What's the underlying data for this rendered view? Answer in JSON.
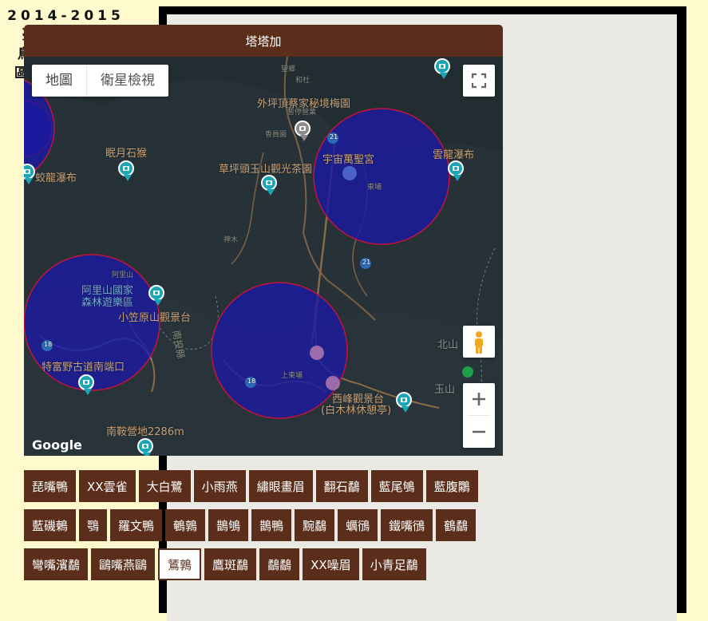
{
  "sidebar": {
    "title_lines": [
      "2014-2015",
      "臺灣新年數",
      "鳥嘉年華/樣",
      "區圓+鳥分布"
    ]
  },
  "map_panel": {
    "header": "塔塔加",
    "map_type": {
      "map_label": "地圖",
      "satellite_label": "衛星檢視"
    },
    "attribution": "Google",
    "place_labels": {
      "waishan": "外坪頂蔡家秘境梅園",
      "waishan_sub": "暫停營業",
      "caopingtou": "草坪頭玉山觀光茶園",
      "yuzhou": "宇宙萬聖宮",
      "yunlong": "雲龍瀑布",
      "meiyue": "眠月石猴",
      "jiaolong": "蛟龍瀑布",
      "alishan_forest": "阿里山國家\n森林遊樂區",
      "xiaoliyuan": "小笠原山觀景台",
      "tefu": "特富野古道南端口",
      "xifeng": "西峰觀景台",
      "xifeng_sub": "(白木林休憩亭)",
      "nanan": "南鞍營地2286m",
      "beishan": "北山",
      "yushan": "玉山",
      "road_21a": "21",
      "road_21b": "21",
      "road_18a": "18",
      "road_18b": "18",
      "alishan_small": "阿里山",
      "shenmu": "神木",
      "tataka": "上東埔",
      "heshe": "和社",
      "wangxiang": "望鄉",
      "xinzhong": "香員園",
      "dongpu": "東埔",
      "nanzhi": "南投縣"
    }
  },
  "colors": {
    "accent": "#5a2e1a",
    "circle_fill": "#1c1aa0",
    "circle_stroke": "#c0143c",
    "marker": "#1aa6b7"
  },
  "bird_buttons": {
    "rows": [
      [
        "琵嘴鴨",
        "XX雲雀",
        "大白鷺",
        "小雨燕",
        "繡眼畫眉",
        "翻石鷸",
        "藍尾鴝",
        "藍腹鷴"
      ],
      [
        "藍磯鶇",
        "鶚",
        "羅文鴨",
        "鵪鶉",
        "鵲鴝",
        "鵲鴨",
        "黦鷸",
        "蠣鴴",
        "鐵嘴鴴",
        "鶴鷸"
      ],
      [
        "彎嘴濱鷸",
        "鷗嘴燕鷗",
        "鵟鶉",
        "鷹斑鷸",
        "鷸鷸",
        "XX噪眉",
        "小青足鷸"
      ]
    ],
    "selected": "鵟鶉"
  }
}
